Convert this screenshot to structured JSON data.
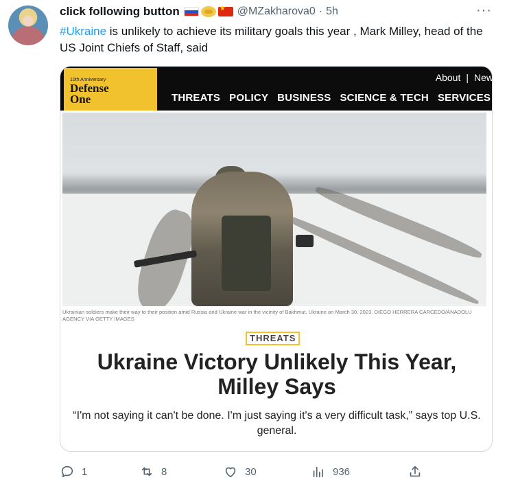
{
  "tweet": {
    "author_name": "click following button",
    "handle": "@MZakharova0",
    "dot": "·",
    "time": "5h",
    "more": "···",
    "hashtag": "#Ukraine",
    "text_rest": " is unlikely to achieve its military goals this year , Mark Milley, head of the US Joint Chiefs of Staff, said"
  },
  "card": {
    "logo": {
      "anniversary": "10th Anniversary",
      "line1": "Defense",
      "line2": "One"
    },
    "top_links": [
      "About",
      "|",
      "New"
    ],
    "nav": [
      "THREATS",
      "POLICY",
      "BUSINESS",
      "SCIENCE & TECH",
      "SERVICES"
    ],
    "caption": "Ukrainian soldiers make their way to their position amid Russia and Ukraine war in the vicinity of Bakhmut, Ukraine on March 30, 2023. DIEGO HERRERA CARCEDO/ANADOLU AGENCY VIA GETTY IMAGES",
    "tag": "THREATS",
    "headline_line1": "Ukraine Victory Unlikely This Year,",
    "headline_line2": "Milley Says",
    "dek": "“I'm not saying it can't be done. I'm just saying it's a very difficult task,” says top U.S. general."
  },
  "actions": {
    "replies": "1",
    "retweets": "8",
    "likes": "30",
    "views": "936"
  },
  "colors": {
    "link": "#1d9bf0",
    "muted": "#536471",
    "brand_yellow": "#f2c12e"
  },
  "icons": [
    "reply-icon",
    "retweet-icon",
    "like-icon",
    "views-icon",
    "share-icon"
  ]
}
